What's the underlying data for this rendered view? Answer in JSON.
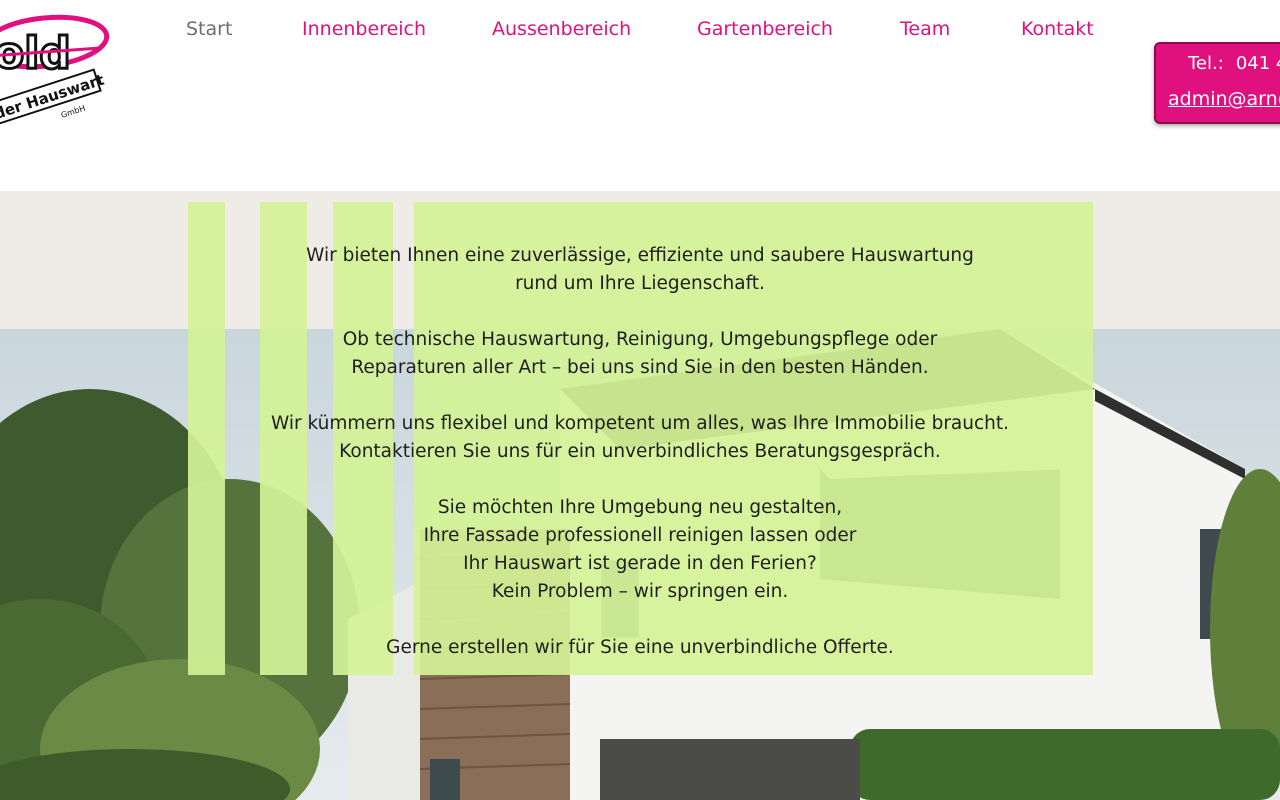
{
  "logo": {
    "text": "old",
    "subtitle": "der Hauswart",
    "company_form": "GmbH"
  },
  "nav": {
    "items": [
      {
        "label": "Start",
        "active": true
      },
      {
        "label": "Innenbereich"
      },
      {
        "label": "Aussenbereich"
      },
      {
        "label": "Gartenbereich"
      },
      {
        "label": "Team"
      },
      {
        "label": "Kontakt"
      }
    ]
  },
  "contact": {
    "tel_label": "Tel.:",
    "tel_number": "041 4",
    "email": "admin@arno"
  },
  "intro": {
    "line1": "Wir bieten Ihnen eine zuverlässige, effiziente und saubere Hauswartung",
    "line2": "rund um Ihre Liegenschaft.",
    "line3": "Ob technische Hauswartung, Reinigung, Umgebungspflege oder",
    "line4": "Reparaturen aller Art – bei uns sind Sie in den besten Händen.",
    "line5": "Wir kümmern uns flexibel und kompetent um alles, was Ihre Immobilie braucht.",
    "line6": "Kontaktieren Sie uns für ein unverbindliches Beratungsgespräch.",
    "line7": "Sie möchten Ihre Umgebung neu gestalten,",
    "line8": "Ihre Fassade professionell reinigen lassen oder",
    "line9": "Ihr Hauswart ist gerade in den Ferien?",
    "line10": "Kein Problem – wir springen ein.",
    "line11": "Gerne erstellen wir für Sie eine unverbindliche Offerte."
  },
  "colors": {
    "brand": "#e0117e",
    "overlay": "#d4f296",
    "band": "#efebe6"
  }
}
